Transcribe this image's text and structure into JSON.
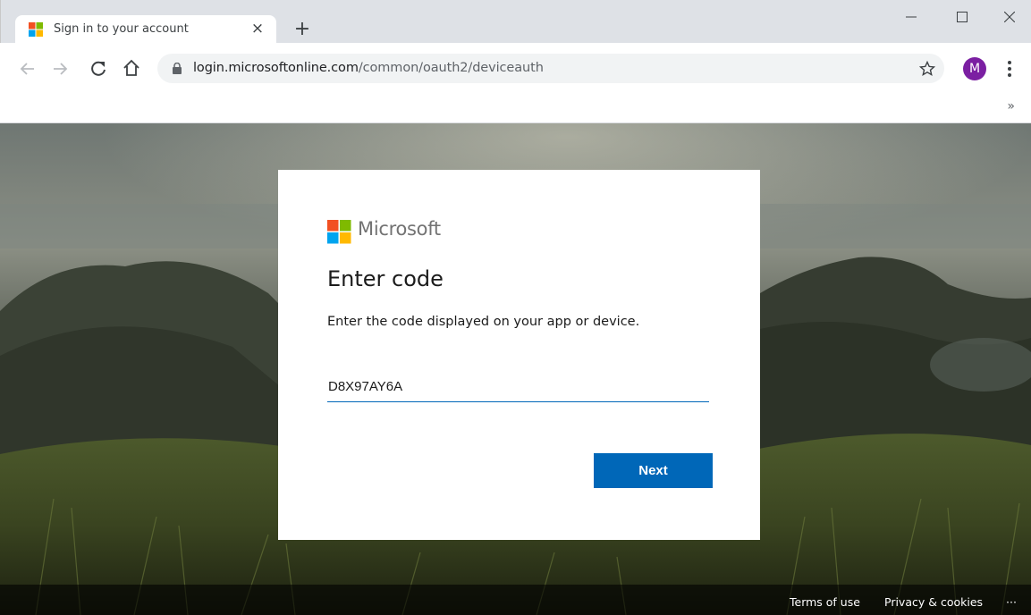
{
  "browser": {
    "tab_title": "Sign in to your account",
    "tab_close_icon": "close-icon",
    "new_tab_label": "+",
    "url_host": "login.microsoftonline.com",
    "url_path": "/common/oauth2/deviceauth",
    "profile_initial": "M",
    "window": {
      "minimize": "—",
      "maximize": "☐",
      "close": "✕"
    },
    "bookmarks_more": "»",
    "icons": [
      "back-icon",
      "forward-icon",
      "reload-icon",
      "home-icon",
      "lock-icon",
      "star-icon",
      "menu-icon"
    ]
  },
  "card": {
    "brand_name": "Microsoft",
    "title": "Enter code",
    "description": "Enter the code displayed on your app or device.",
    "code_value": "D8X97AY6A",
    "next_label": "Next"
  },
  "footer": {
    "terms": "Terms of use",
    "privacy": "Privacy & cookies",
    "more": "···"
  },
  "colors": {
    "accent": "#0067b8",
    "ms_red": "#f25022",
    "ms_green": "#7fba00",
    "ms_blue": "#00a4ef",
    "ms_yellow": "#ffb900",
    "avatar": "#7b1fa2"
  }
}
